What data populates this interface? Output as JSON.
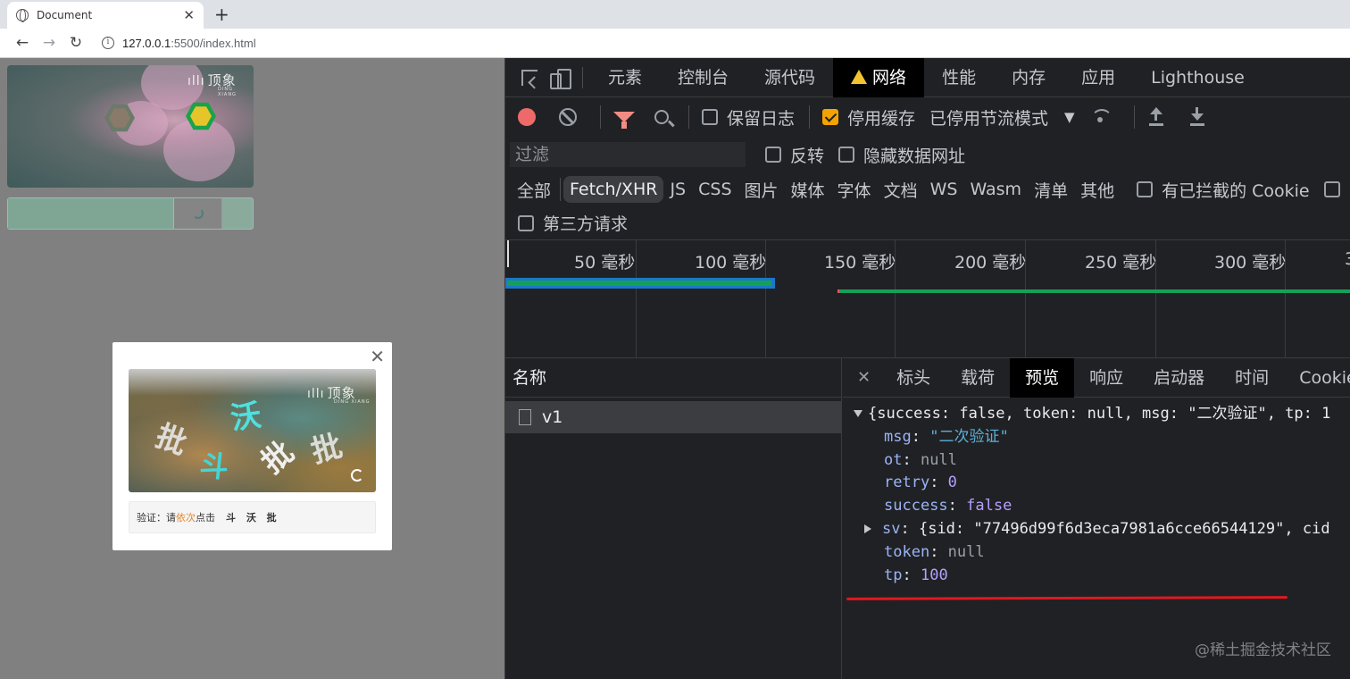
{
  "browser": {
    "tab_title": "Document",
    "tab_close": "✕",
    "new_tab": "+",
    "url_host": "127.0.0.1",
    "url_path": ":5500/index.html"
  },
  "page": {
    "thumbnail_logo": "顶象",
    "thumbnail_logo_sub": "DING XIANG",
    "captcha": {
      "close": "✕",
      "image_logo": "顶象",
      "image_logo_sub": "DING XIANG",
      "image_chars": [
        "沃",
        "斗",
        "批",
        "批"
      ],
      "prompt_prefix": "验证：请",
      "prompt_accent": "依次",
      "prompt_suffix": "点击",
      "target_chars": "斗 沃 批"
    }
  },
  "devtools": {
    "tabs": [
      "元素",
      "控制台",
      "源代码",
      "网络",
      "性能",
      "内存",
      "应用",
      "Lighthouse"
    ],
    "active_tab": "网络",
    "toolbar": {
      "preserve_log": "保留日志",
      "disable_cache": "停用缓存",
      "throttling": "已停用节流模式"
    },
    "filter": {
      "placeholder": "过滤",
      "invert": "反转",
      "hide_data_urls": "隐藏数据网址"
    },
    "types": [
      "全部",
      "Fetch/XHR",
      "JS",
      "CSS",
      "图片",
      "媒体",
      "字体",
      "文档",
      "WS",
      "Wasm",
      "清单",
      "其他"
    ],
    "active_type": "Fetch/XHR",
    "blocked_cookies": "有已拦截的 Cookie",
    "third_party": "第三方请求",
    "timeline_labels": [
      "50 毫秒",
      "100 毫秒",
      "150 毫秒",
      "200 毫秒",
      "250 毫秒",
      "300 毫秒",
      "3"
    ],
    "names_header": "名称",
    "request_name": "v1",
    "detail_tabs": [
      "标头",
      "载荷",
      "预览",
      "响应",
      "启动器",
      "时间",
      "Cookie"
    ],
    "active_detail_tab": "预览",
    "preview": {
      "summary": "{success: false, token: null, msg: \"二次验证\", tp: 1",
      "msg_key": "msg",
      "msg_val": "\"二次验证\"",
      "ot_key": "ot",
      "ot_val": "null",
      "retry_key": "retry",
      "retry_val": "0",
      "success_key": "success",
      "success_val": "false",
      "sv_key": "sv",
      "sv_val_prefix": "{sid: ",
      "sv_sid": "\"77496d99f6d3eca7981a6cce66544129\"",
      "sv_val_suffix": ", cid",
      "token_key": "token",
      "token_val": "null",
      "tp_key": "tp",
      "tp_val": "100"
    },
    "watermark": "@稀土掘金技术社区"
  }
}
